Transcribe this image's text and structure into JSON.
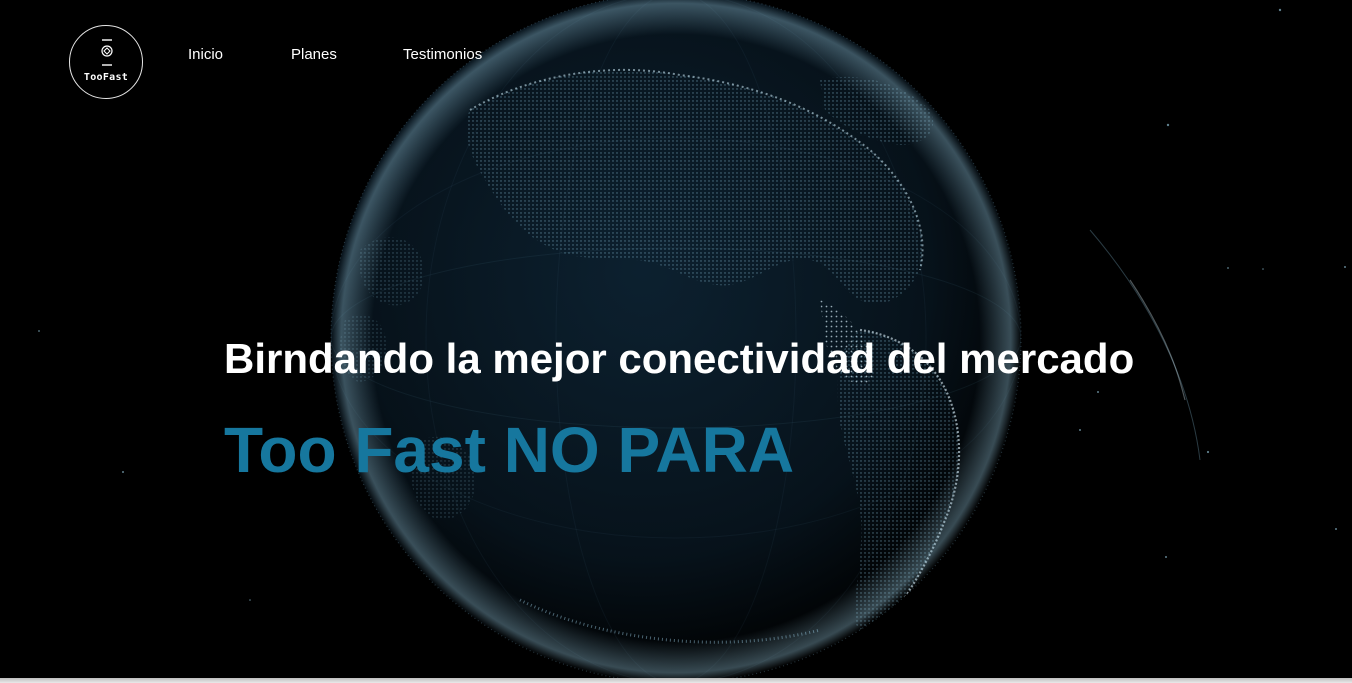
{
  "logo": {
    "text": "TooFast",
    "mark_icon": "router-icon"
  },
  "nav": {
    "items": [
      {
        "label": "Inicio"
      },
      {
        "label": "Planes"
      },
      {
        "label": "Testimonios"
      }
    ]
  },
  "hero": {
    "subtitle": "Birndando la mejor conectividad del mercado",
    "title": "Too Fast NO PARA",
    "background_icon": "digital-globe-icon"
  },
  "colors": {
    "background": "#000000",
    "text": "#ffffff",
    "accent": "#16779e",
    "globe_glow": "#9fd3ea"
  }
}
